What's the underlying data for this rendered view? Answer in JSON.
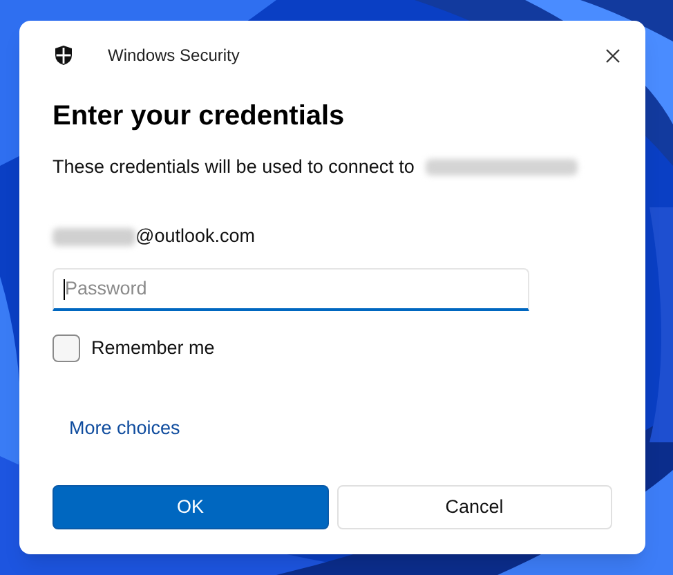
{
  "window": {
    "title": "Windows Security"
  },
  "heading": "Enter your credentials",
  "description": "These credentials will be used to connect to",
  "account": {
    "suffix": "@outlook.com"
  },
  "password": {
    "placeholder": "Password",
    "focused": true
  },
  "remember": {
    "label": "Remember me",
    "checked": false
  },
  "more_choices": "More choices",
  "buttons": [
    {
      "label": "OK",
      "kind": "primary"
    },
    {
      "label": "Cancel",
      "kind": "secondary"
    }
  ]
}
